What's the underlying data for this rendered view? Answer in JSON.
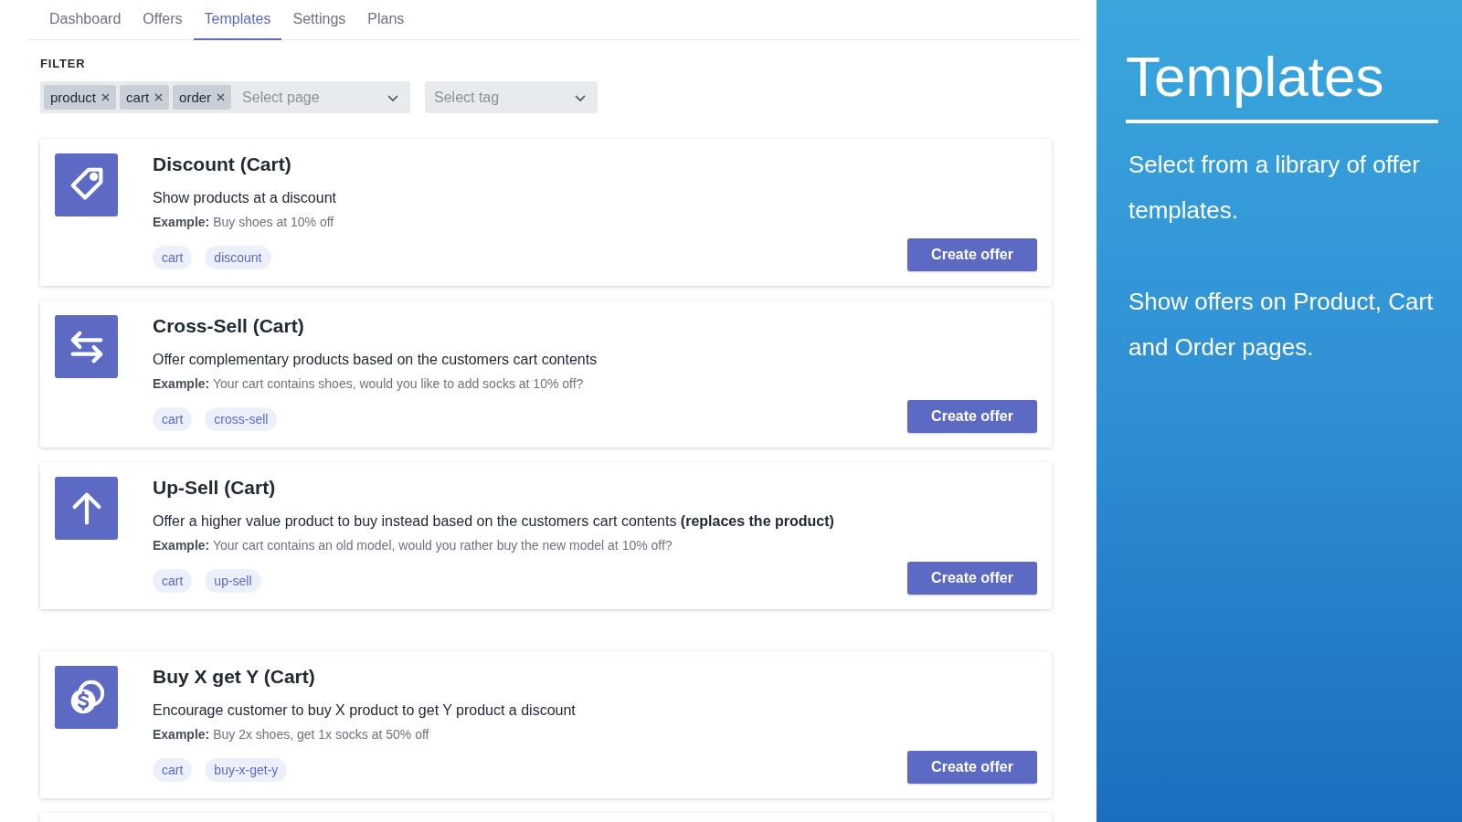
{
  "tabs": [
    {
      "label": "Dashboard",
      "selected": false
    },
    {
      "label": "Offers",
      "selected": false
    },
    {
      "label": "Templates",
      "selected": true
    },
    {
      "label": "Settings",
      "selected": false
    },
    {
      "label": "Plans",
      "selected": false
    }
  ],
  "filter": {
    "label": "FILTER",
    "chips": [
      "product",
      "cart",
      "order"
    ],
    "page_select": {
      "placeholder": "Select page"
    },
    "tag_select": {
      "placeholder": "Select tag"
    }
  },
  "cards": [
    {
      "kind": "tag",
      "title": "Discount (Cart)",
      "description": "Show products at a discount",
      "example": "**Example:** Buy shoes at 10% off",
      "tags": [
        "cart",
        "discount"
      ],
      "button": "Create offer"
    },
    {
      "kind": "arrows",
      "title": "Cross-Sell (Cart)",
      "description": "Offer complementary products based on the customers cart contents",
      "example": "**Example:** Your cart contains shoes, would you like to add socks at 10% off?",
      "tags": [
        "cart",
        "cross-sell"
      ],
      "button": "Create offer"
    },
    {
      "kind": "arrow-up",
      "title": "Up-Sell (Cart)",
      "description": "Offer a higher value product to buy instead based on the customers cart contents **(replaces the product)**",
      "example": "**Example:** Your cart contains an old model, would you rather buy the new model at 10% off?",
      "tags": [
        "cart",
        "up-sell"
      ],
      "button": "Create offer"
    },
    {
      "kind": "coins",
      "title": "Buy X get Y (Cart)",
      "description": "Encourage customer to buy X product to get Y product a discount",
      "example": "**Example:** Buy 2x shoes, get 1x socks at 50% off",
      "tags": [
        "cart",
        "buy-x-get-y"
      ],
      "button": "Create offer"
    }
  ],
  "more_cards_below": true,
  "side_panel": {
    "title": "Templates",
    "paragraphs": [
      "Select from a library of offer templates.",
      "Show offers on Product, Cart and Order pages."
    ]
  }
}
